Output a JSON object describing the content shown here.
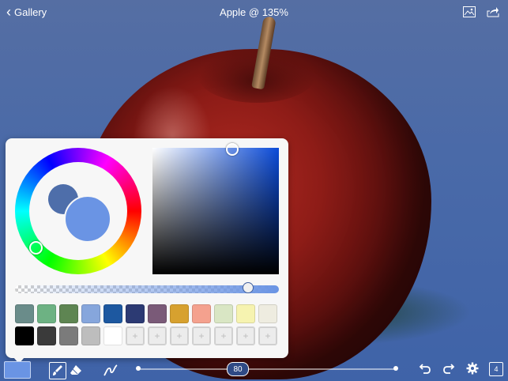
{
  "topbar": {
    "back_label": "Gallery",
    "title": "Apple @ 135%"
  },
  "color_picker": {
    "current_color": "#6a94e4",
    "previous_color": "#4e6eaa",
    "opacity_fraction": 0.88,
    "palette_row1": [
      "#6a8c8a",
      "#6db283",
      "#5e8552",
      "#86a6dc",
      "#1d58a0",
      "#2c3a73",
      "#7a5a78",
      "#d7a12f",
      "#f4a18e",
      "#d9e6c4",
      "#f6f3b0",
      "#eeece0"
    ],
    "palette_row2": [
      "#000000",
      "#3a3a3a",
      "#7b7b7b",
      "#bdbdbd",
      "#ffffff",
      "",
      "",
      "",
      "",
      "",
      "",
      ""
    ]
  },
  "bottombar": {
    "brush_size": "80",
    "layer_count": "4"
  },
  "icons": {
    "back": "chevron-left-icon",
    "image": "image-icon",
    "share": "share-icon",
    "brush": "brush-icon",
    "eraser": "eraser-icon",
    "smudge": "smudge-icon",
    "undo": "undo-icon",
    "redo": "redo-icon",
    "settings": "gear-icon",
    "layers": "layers-icon"
  }
}
